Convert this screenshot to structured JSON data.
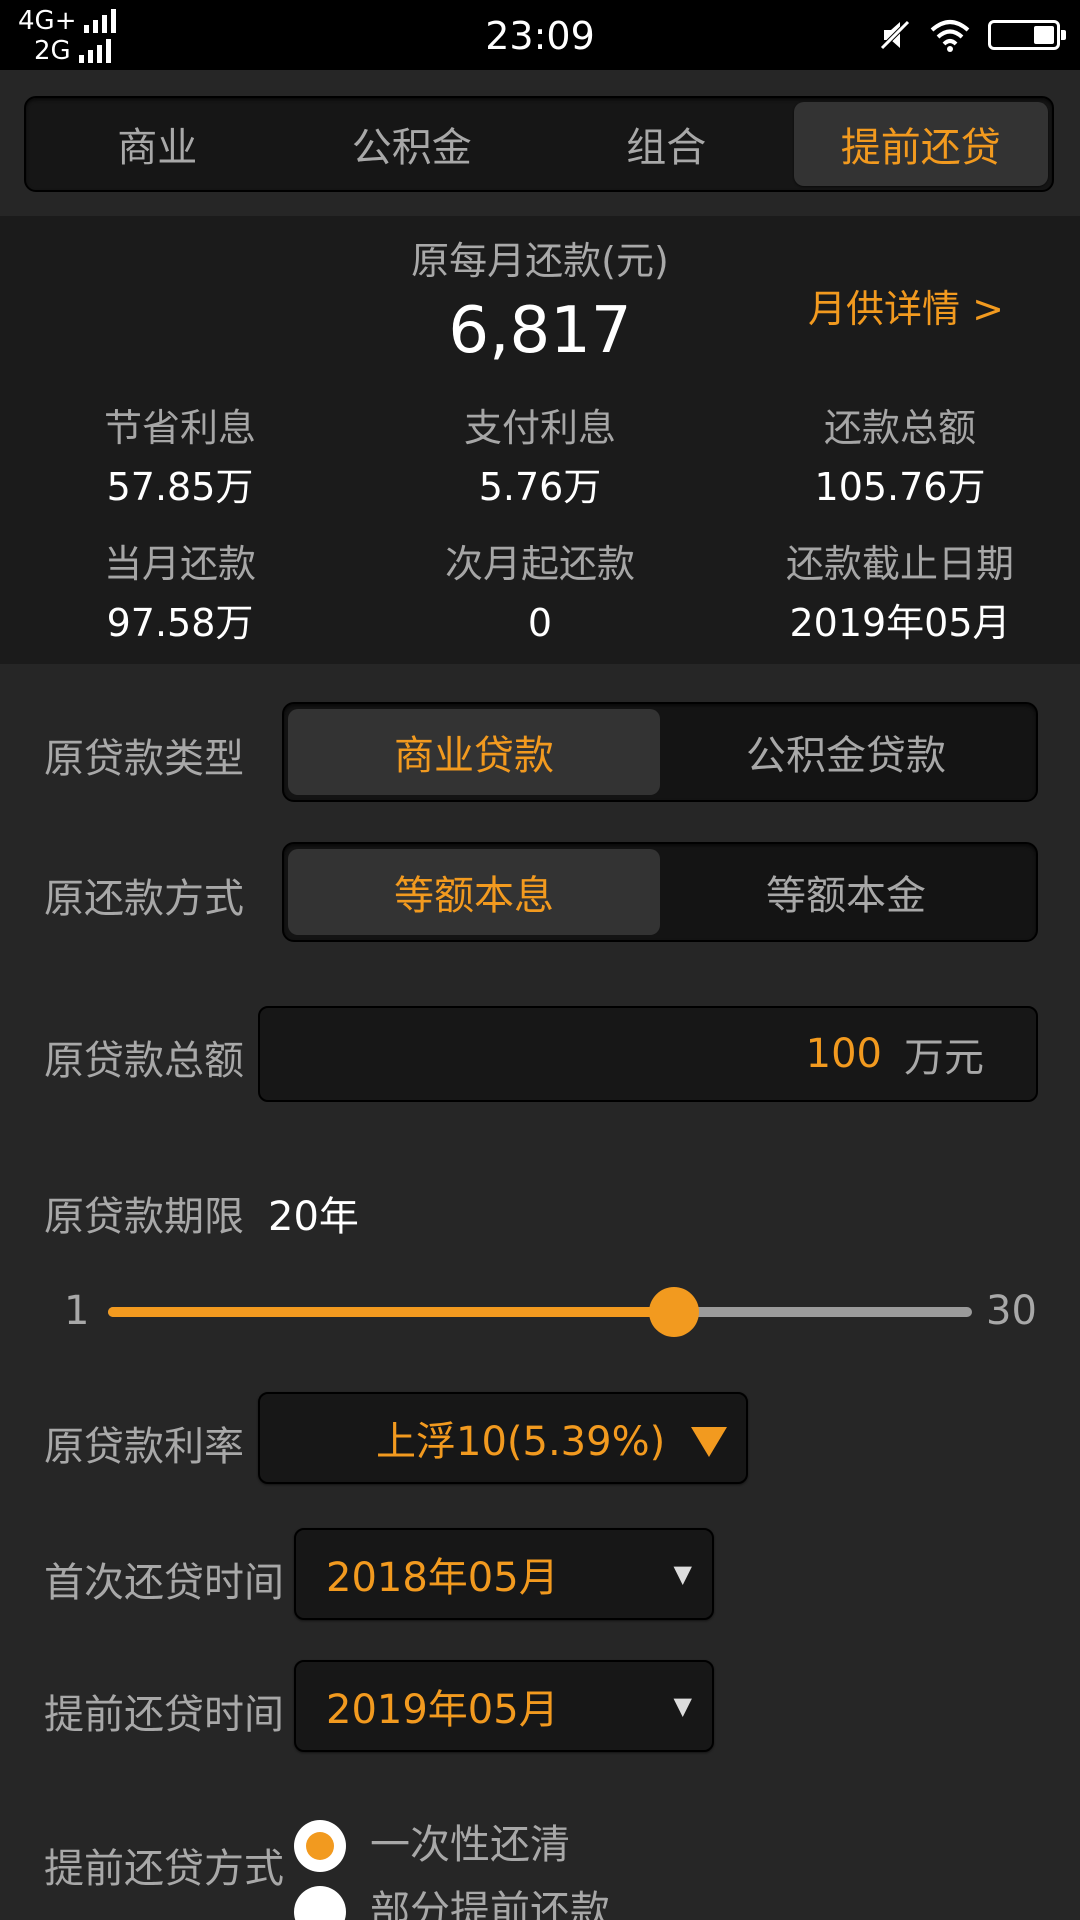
{
  "status_bar": {
    "network_top": "4G+",
    "network_bottom": "2G",
    "time": "23:09",
    "icons": [
      "signal-bars-icon",
      "mute-icon",
      "wifi-icon",
      "battery-icon"
    ]
  },
  "tabs": [
    {
      "label": "商业",
      "active": false
    },
    {
      "label": "公积金",
      "active": false
    },
    {
      "label": "组合",
      "active": false
    },
    {
      "label": "提前还贷",
      "active": true
    }
  ],
  "summary": {
    "monthly_label": "原每月还款(元)",
    "monthly_value": "6,817",
    "detail_link": "月供详情 >",
    "stats": [
      {
        "label": "节省利息",
        "value": "57.85万"
      },
      {
        "label": "支付利息",
        "value": "5.76万"
      },
      {
        "label": "还款总额",
        "value": "105.76万"
      },
      {
        "label": "当月还款",
        "value": "97.58万"
      },
      {
        "label": "次月起还款",
        "value": "0"
      },
      {
        "label": "还款截止日期",
        "value": "2019年05月"
      }
    ]
  },
  "form": {
    "loan_type": {
      "label": "原贷款类型",
      "options": [
        "商业贷款",
        "公积金贷款"
      ],
      "selected": "商业贷款"
    },
    "repay_method": {
      "label": "原还款方式",
      "options": [
        "等额本息",
        "等额本金"
      ],
      "selected": "等额本息"
    },
    "amount": {
      "label": "原贷款总额",
      "value": "100",
      "unit": "万元"
    },
    "term": {
      "label": "原贷款期限",
      "value": "20年",
      "min": "1",
      "max": "30",
      "current": 20
    },
    "rate": {
      "label": "原贷款利率",
      "value": "上浮10(5.39%)"
    },
    "first_repay": {
      "label": "首次还贷时间",
      "value": "2018年05月"
    },
    "prepay_time": {
      "label": "提前还贷时间",
      "value": "2019年05月"
    },
    "prepay_method": {
      "label": "提前还贷方式",
      "options": [
        "一次性还清",
        "部分提前还款"
      ],
      "selected": "一次性还清"
    }
  },
  "colors": {
    "accent": "#f29a1f",
    "background": "#262626",
    "summary_bg": "#1b1b1b"
  }
}
